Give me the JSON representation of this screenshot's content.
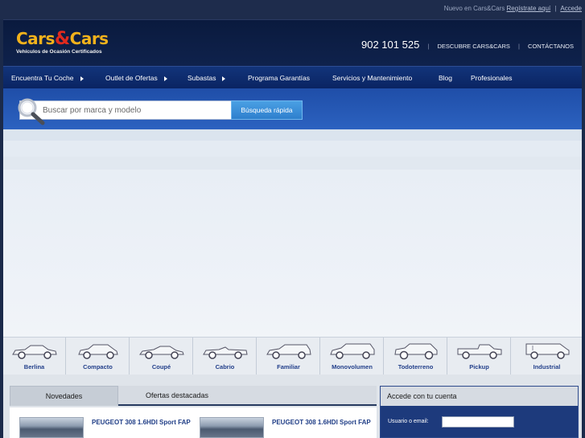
{
  "topbar": {
    "new_text": "Nuevo en Cars&Cars",
    "register_label": "Regístrate aquí",
    "separator": "|",
    "login_label": "Accede"
  },
  "header": {
    "brand_left": "Cars",
    "brand_amp": "&",
    "brand_right": "Cars",
    "tagline": "Vehículos de Ocasión Certificados",
    "phone": "902 101 525",
    "separator": "|",
    "link_discover": "DESCUBRE CARS&CARS",
    "link_contact": "CONTÁCTANOS"
  },
  "nav": {
    "items": [
      {
        "label": "Encuentra Tu Coche"
      },
      {
        "label": "Outlet de Ofertas"
      },
      {
        "label": "Subastas"
      },
      {
        "label": "Programa Garantías"
      },
      {
        "label": "Servicios y Mantenimiento"
      },
      {
        "label": "Blog"
      },
      {
        "label": "Profesionales"
      }
    ]
  },
  "search": {
    "placeholder": "Buscar por marca y modelo",
    "button_label": "Búsqueda rápida"
  },
  "categories": [
    {
      "label": "Berlina",
      "icon": "sedan-icon"
    },
    {
      "label": "Compacto",
      "icon": "hatchback-icon"
    },
    {
      "label": "Coupé",
      "icon": "coupe-icon"
    },
    {
      "label": "Cabrio",
      "icon": "convertible-icon"
    },
    {
      "label": "Familiar",
      "icon": "estate-icon"
    },
    {
      "label": "Monovolumen",
      "icon": "minivan-icon"
    },
    {
      "label": "Todoterreno",
      "icon": "suv-icon"
    },
    {
      "label": "Pickup",
      "icon": "pickup-icon"
    },
    {
      "label": "Industrial",
      "icon": "van-icon"
    }
  ],
  "tabs": {
    "active": "Novedades",
    "other": "Ofertas destacadas"
  },
  "cards": [
    {
      "title": "PEUGEOT 308 1.6HDI Sport FAP"
    },
    {
      "title": "PEUGEOT 308 1.6HDI Sport FAP"
    }
  ],
  "login": {
    "heading": "Accede con tu cuenta",
    "user_label": "Usuario o email:",
    "user_value": ""
  },
  "colors": {
    "brand_yellow": "#f2b21c",
    "brand_red": "#e02a1e",
    "nav_blue": "#0a2462",
    "search_blue": "#2c62c0",
    "category_text": "#223f8a"
  }
}
